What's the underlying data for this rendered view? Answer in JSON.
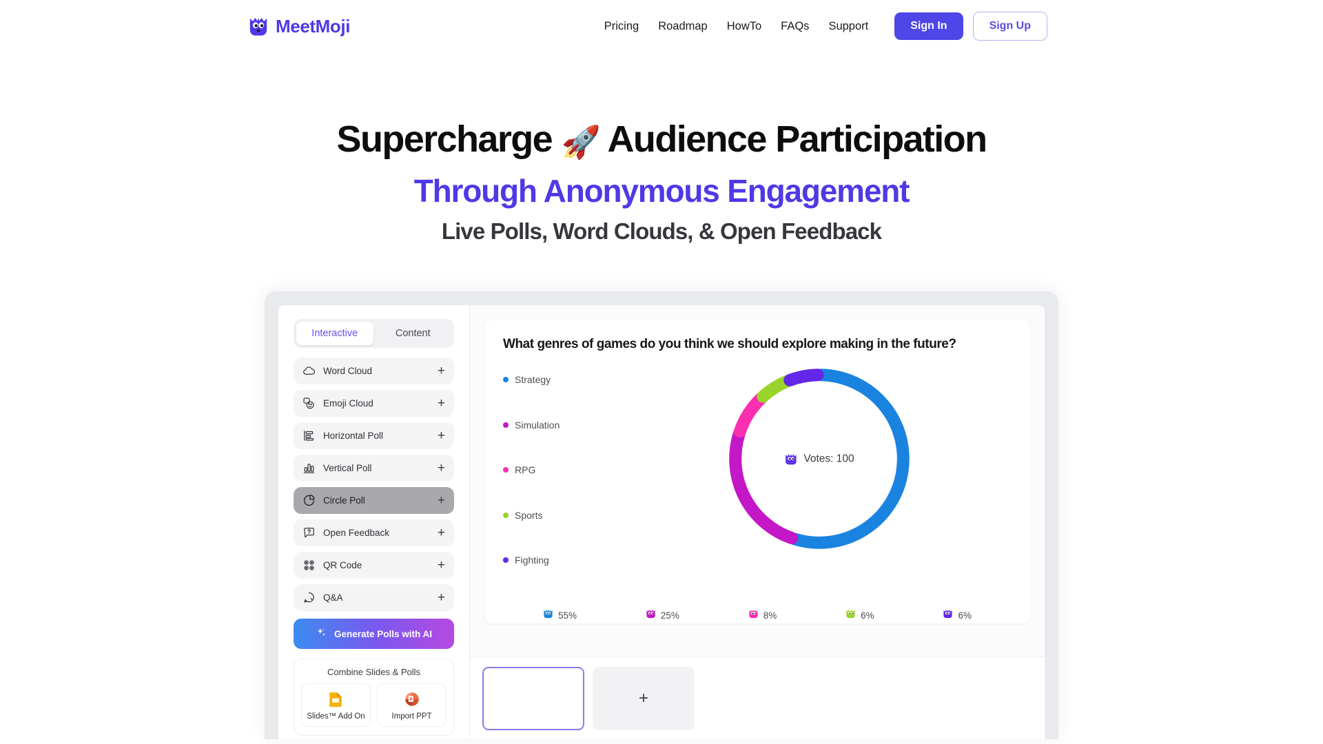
{
  "header": {
    "brand": {
      "name": "MeetMoji",
      "icon": "meetmoji-ghost-logo",
      "color": "#4f39e6"
    },
    "nav_links": [
      {
        "label": "Pricing"
      },
      {
        "label": "Roadmap"
      },
      {
        "label": "HowTo"
      },
      {
        "label": "FAQs"
      },
      {
        "label": "Support"
      }
    ],
    "sign_in_label": "Sign In",
    "sign_up_label": "Sign Up"
  },
  "hero": {
    "line1_a": "Supercharge ",
    "line1_emoji": "🚀",
    "line1_b": " Audience Participation",
    "line2": "Through Anonymous Engagement",
    "line3": "Live Polls, Word Clouds, & Open Feedback"
  },
  "app": {
    "sidebar": {
      "tabs": [
        {
          "label": "Interactive",
          "selected": true
        },
        {
          "label": "Content",
          "selected": false
        }
      ],
      "tools": [
        {
          "label": "Word Cloud",
          "icon": "cloud-icon",
          "add": "+",
          "selected": false
        },
        {
          "label": "Emoji Cloud",
          "icon": "emoji-cloud-icon",
          "add": "+",
          "selected": false
        },
        {
          "label": "Horizontal Poll",
          "icon": "horizontal-bars-icon",
          "add": "+",
          "selected": false
        },
        {
          "label": "Vertical Poll",
          "icon": "vertical-bars-icon",
          "add": "+",
          "selected": false
        },
        {
          "label": "Circle Poll",
          "icon": "pie-chart-icon",
          "add": "+",
          "selected": true
        },
        {
          "label": "Open Feedback",
          "icon": "question-bubble-icon",
          "add": "+",
          "selected": false
        },
        {
          "label": "QR Code",
          "icon": "qr-code-icon",
          "add": "+",
          "selected": false
        },
        {
          "label": "Q&A",
          "icon": "speech-bubble-icon",
          "add": "+",
          "selected": false
        }
      ],
      "ai_button": {
        "label": "Generate Polls with AI",
        "icon": "sparkles-icon"
      },
      "combine": {
        "title": "Combine Slides & Polls",
        "cards": [
          {
            "label": "Slides™ Add On",
            "icon": "google-slides-icon"
          },
          {
            "label": "Import PPT",
            "icon": "powerpoint-icon"
          }
        ]
      }
    },
    "slide": {
      "question": "What genres of games do you think we should explore making in the future?",
      "votes_label": "Votes: 100",
      "votes_icon": "ghost-icon"
    },
    "slide_strip": {
      "thumbnails": [
        {
          "selected": true
        }
      ],
      "add_label": "+"
    }
  },
  "chart_data": {
    "type": "pie",
    "title": "What genres of games do you think we should explore making in the future?",
    "categories": [
      "Strategy",
      "Simulation",
      "RPG",
      "Sports",
      "Fighting"
    ],
    "values": [
      55,
      25,
      8,
      6,
      6
    ],
    "value_labels": [
      "55%",
      "25%",
      "8%",
      "6%",
      "6%"
    ],
    "colors": [
      "#1a83e0",
      "#c417c7",
      "#fa2fb0",
      "#9ad32a",
      "#6327ea"
    ],
    "total_votes": 100,
    "center_text": "Votes: 100",
    "legend_position": "left",
    "donut": true,
    "xlabel": "",
    "ylabel": ""
  }
}
